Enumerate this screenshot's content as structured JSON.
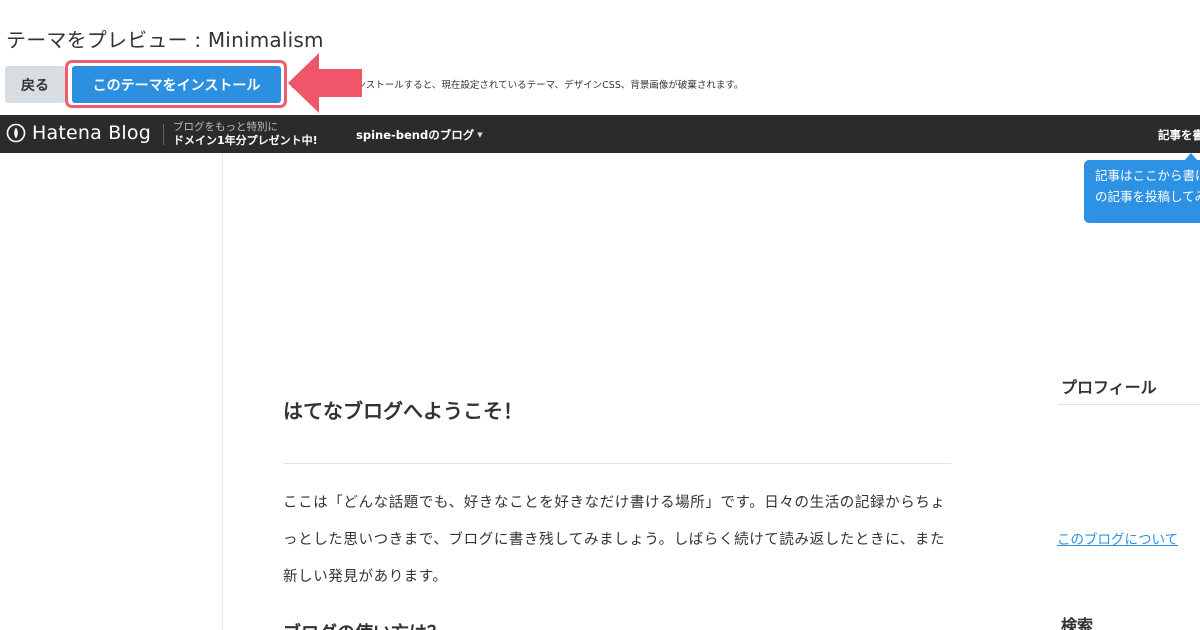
{
  "preview": {
    "title": "テーマをプレビュー : Minimalism",
    "back_label": "戻る",
    "install_label": "このテーマをインストール",
    "install_note": "このテーマをインストールすると、現在設定されているテーマ、デザインCSS、背景画像が破棄されます。",
    "callout_color": "#f0566a"
  },
  "topbar": {
    "logo_text": "Hatena Blog",
    "promo_line1": "ブログをもっと特別に",
    "promo_line2": "ドメイン1年分プレゼント中!",
    "blog_menu_label": "spine-bendのブログ",
    "write_label": "記事を書く",
    "background": "#2b2b2b"
  },
  "tooltip": {
    "line1": "記事はここから書けます",
    "line2": "の記事を投稿してみましょう"
  },
  "article": {
    "title": "はてなブログへようこそ！",
    "body": "ここは「どんな話題でも、好きなことを好きなだけ書ける場所」です。日々の生活の記録からちょっとした思いつきまで、ブログに書き残してみましょう。しばらく続けて読み返したときに、また新しい発見があります。",
    "subheading": "ブログの使い方は？"
  },
  "sidebar": {
    "profile_heading": "プロフィール",
    "about_link": "このブログについて",
    "search_heading": "検索"
  },
  "colors": {
    "accent": "#2d8fe0",
    "highlight_ring": "#ec5d6d"
  }
}
